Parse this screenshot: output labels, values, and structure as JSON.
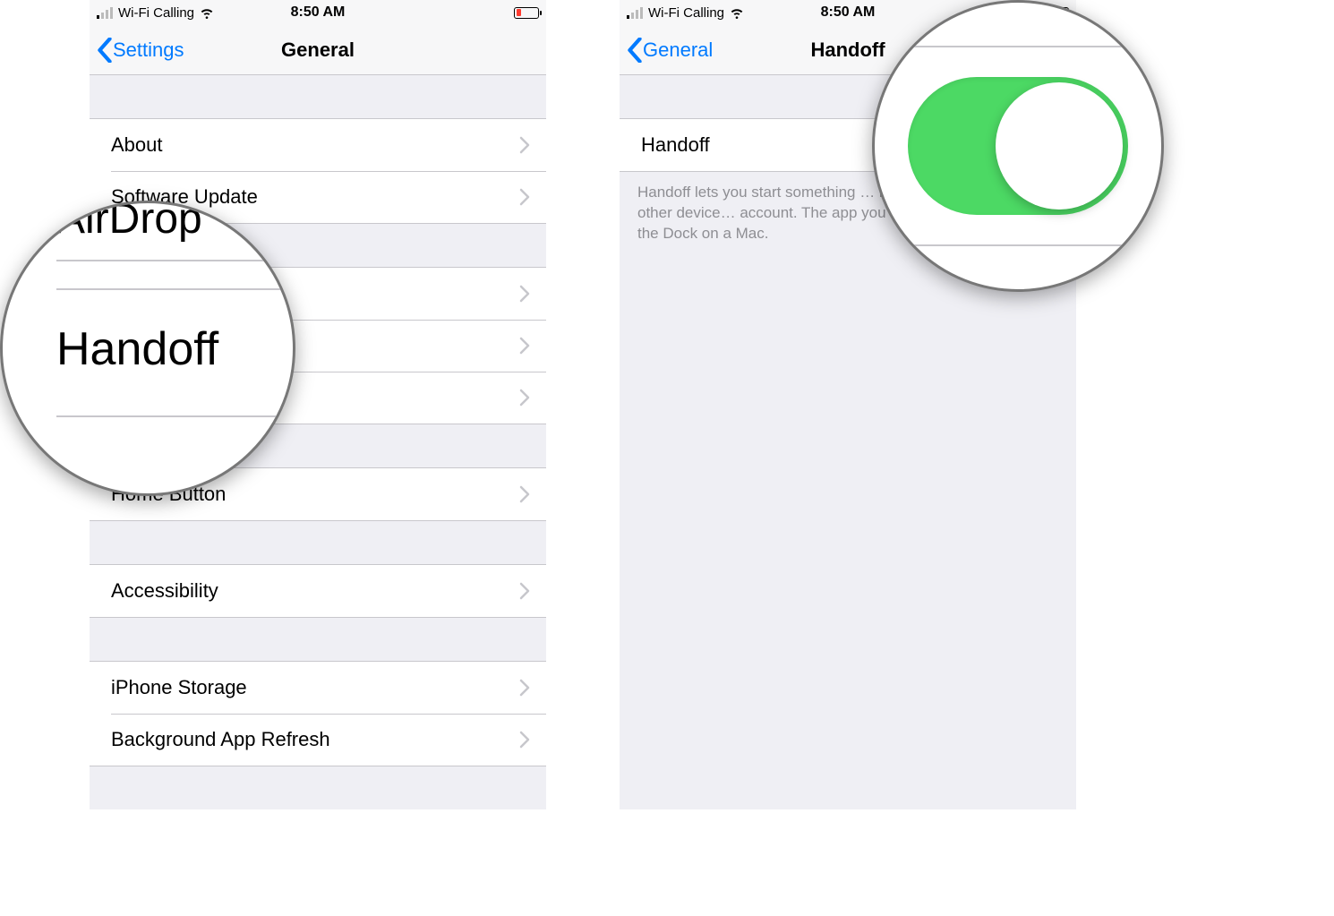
{
  "status": {
    "carrier": "Wi-Fi Calling",
    "time": "8:50 AM"
  },
  "left": {
    "back_label": "Settings",
    "title": "General",
    "groups": [
      {
        "rows": [
          "About",
          "Software Update"
        ]
      },
      {
        "rows": [
          "",
          "",
          ""
        ]
      },
      {
        "rows": [
          "Home Button"
        ]
      },
      {
        "rows": [
          "Accessibility"
        ]
      },
      {
        "rows": [
          "iPhone Storage",
          "Background App Refresh"
        ]
      }
    ]
  },
  "right": {
    "back_label": "General",
    "title": "Handoff",
    "toggle_row_label": "Handoff",
    "toggle_on": true,
    "footer": "Handoff lets you start something … instantly pick it up on other device… account. The app you need appears… and in the Dock on a Mac."
  },
  "magnifier_left": {
    "top": "AirDrop",
    "main": "Handoff"
  },
  "colors": {
    "ios_blue": "#007aff",
    "ios_green": "#4cd964",
    "separator": "#c8c7cc",
    "secondary_text": "#8e8e93",
    "group_bg": "#efeff4",
    "battery_low": "#ff3b30"
  }
}
